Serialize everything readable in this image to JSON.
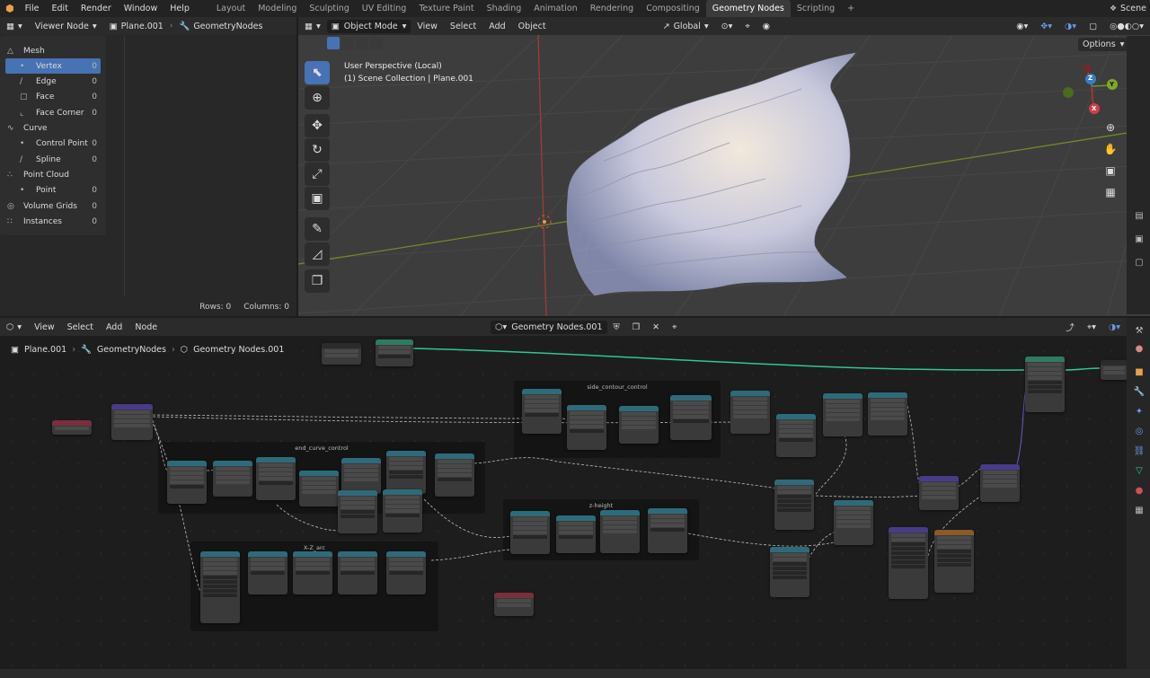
{
  "topbar": {
    "menus": [
      "File",
      "Edit",
      "Render",
      "Window",
      "Help"
    ],
    "workspaces": [
      "Layout",
      "Modeling",
      "Sculpting",
      "UV Editing",
      "Texture Paint",
      "Shading",
      "Animation",
      "Rendering",
      "Compositing",
      "Geometry Nodes",
      "Scripting"
    ],
    "active_workspace": "Geometry Nodes",
    "add_tab": "+",
    "scene": "Scene"
  },
  "spreadsheet": {
    "editor_label": "Viewer Node",
    "object": "Plane.001",
    "modifier": "GeometryNodes",
    "rows_label": "Rows: 0",
    "columns_label": "Columns: 0",
    "tree": [
      {
        "label": "Mesh",
        "count": "",
        "level": 0,
        "icon": "mesh-icon",
        "glyph": "△"
      },
      {
        "label": "Vertex",
        "count": "0",
        "level": 1,
        "icon": "vertex-icon",
        "glyph": "•",
        "selected": true
      },
      {
        "label": "Edge",
        "count": "0",
        "level": 1,
        "icon": "edge-icon",
        "glyph": "∕"
      },
      {
        "label": "Face",
        "count": "0",
        "level": 1,
        "icon": "face-icon",
        "glyph": "▢"
      },
      {
        "label": "Face Corner",
        "count": "0",
        "level": 1,
        "icon": "face-corner-icon",
        "glyph": "⌞"
      },
      {
        "label": "Curve",
        "count": "",
        "level": 0,
        "icon": "curve-icon",
        "glyph": "∿"
      },
      {
        "label": "Control Point",
        "count": "0",
        "level": 1,
        "icon": "control-point-icon",
        "glyph": "•"
      },
      {
        "label": "Spline",
        "count": "0",
        "level": 1,
        "icon": "spline-icon",
        "glyph": "∕"
      },
      {
        "label": "Point Cloud",
        "count": "",
        "level": 0,
        "icon": "point-cloud-icon",
        "glyph": "∴"
      },
      {
        "label": "Point",
        "count": "0",
        "level": 1,
        "icon": "point-icon",
        "glyph": "•"
      },
      {
        "label": "Volume Grids",
        "count": "0",
        "level": 0,
        "icon": "volume-icon",
        "glyph": "◎"
      },
      {
        "label": "Instances",
        "count": "0",
        "level": 0,
        "icon": "instances-icon",
        "glyph": "∷"
      }
    ]
  },
  "viewport": {
    "mode": "Object Mode",
    "menus": [
      "View",
      "Select",
      "Add",
      "Object"
    ],
    "orientation": "Global",
    "options": "Options",
    "overlay_line1": "User Perspective (Local)",
    "overlay_line2": "(1) Scene Collection | Plane.001",
    "gizmo": {
      "z": "Z",
      "y": "Y",
      "x": "X"
    }
  },
  "node_editor": {
    "menus": [
      "View",
      "Select",
      "Add",
      "Node"
    ],
    "tree_name": "Geometry Nodes.001",
    "breadcrumb": [
      "Plane.001",
      "GeometryNodes",
      "Geometry Nodes.001"
    ],
    "frames": [
      "side_contour_control",
      "end_curve_control",
      "z-height",
      "X-Z_arc"
    ]
  },
  "colors": {
    "accent": "#4772b3",
    "geometry_link": "#2fc69a",
    "x_axis": "#c44b4b",
    "y_axis": "#7fa828",
    "node_header_math": "#2e6b7a",
    "node_header_input": "#7a2f3d",
    "node_header_geometry": "#2e7b63"
  }
}
